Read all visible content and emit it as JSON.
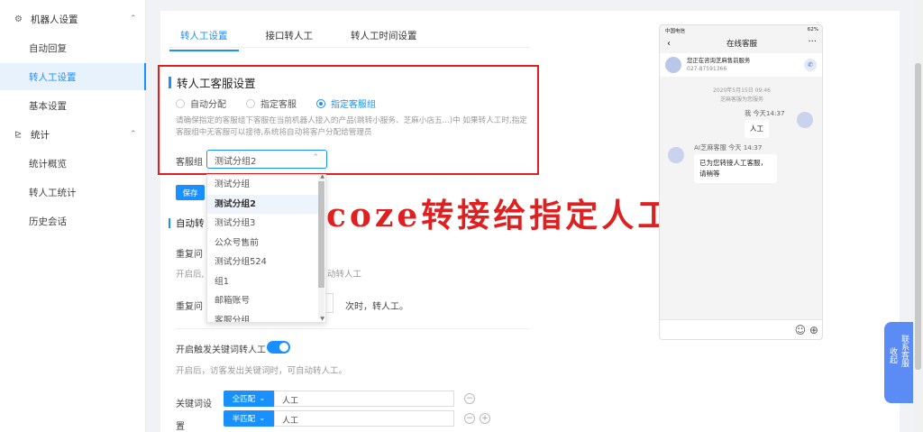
{
  "sidebar": {
    "group1": {
      "label": "机器人设置",
      "icon": "gear-icon",
      "arrow": "⌃"
    },
    "group1_items": [
      "自动回复",
      "转人工设置",
      "基本设置"
    ],
    "group2": {
      "label": "统计",
      "icon": "chart-icon",
      "arrow": "⌃"
    },
    "group2_items": [
      "统计概览",
      "转人工统计",
      "历史会话"
    ],
    "active_item": "转人工设置"
  },
  "tabs": [
    "转人工设置",
    "接口转人工",
    "转人工时间设置"
  ],
  "active_tab": "转人工设置",
  "section": {
    "title": "转人工客服设置",
    "radios": [
      "自动分配",
      "指定客服",
      "指定客服组"
    ],
    "selected_radio": "指定客服组",
    "note": "请确保指定的客服组下客服在当前机器人接入的产品(跳转小服务、芝麻小店五...)中 如果转人工时,指定客服组中无客服可以接待,系统将自动将客户分配给管理员",
    "group_label": "客服组",
    "group_value": "测试分组2",
    "save_label": "保存"
  },
  "dropdown": {
    "options": [
      "测试分组",
      "测试分组2",
      "测试分组3",
      "公众号售前",
      "测试分组524",
      "组1",
      "邮箱账号",
      "客服分组"
    ],
    "selected": "测试分组2"
  },
  "overlay_text": "coze转接给指定人工客服",
  "auto_section": {
    "title": "自动转",
    "repeat_label": "重复问",
    "repeat_hint": "开启后,",
    "repeat_hint_tail": "动转人工",
    "repeat2_label": "重复问",
    "repeat2_tail": "次时，转人工。"
  },
  "keyword": {
    "toggle_label": "开启触发关键词转人工",
    "toggle_on": true,
    "hint": "开启后，访客发出关键词时，可自动转人工。",
    "setting_label": [
      "关键词设",
      "置"
    ],
    "rows": [
      {
        "match": "全匹配",
        "value": "人工"
      },
      {
        "match": "半匹配",
        "value": "人工"
      }
    ]
  },
  "phone": {
    "carrier": "中国电信",
    "battery": "62%",
    "title": "在线客服",
    "service_text": "您正在咨询芝麻售前服务",
    "phone_number": "027-87591366",
    "date": "2020年5月15日 09:46",
    "service_note": "芝麻客服为您服务",
    "user_name": "我 今天14:37",
    "user_msg": "人工",
    "agent_name": "AI芝麻客服 今天 14:37",
    "agent_msg": "已为您转接人工客服，请稍等"
  },
  "float_tab": {
    "left": "收起",
    "right": "联系客服"
  }
}
